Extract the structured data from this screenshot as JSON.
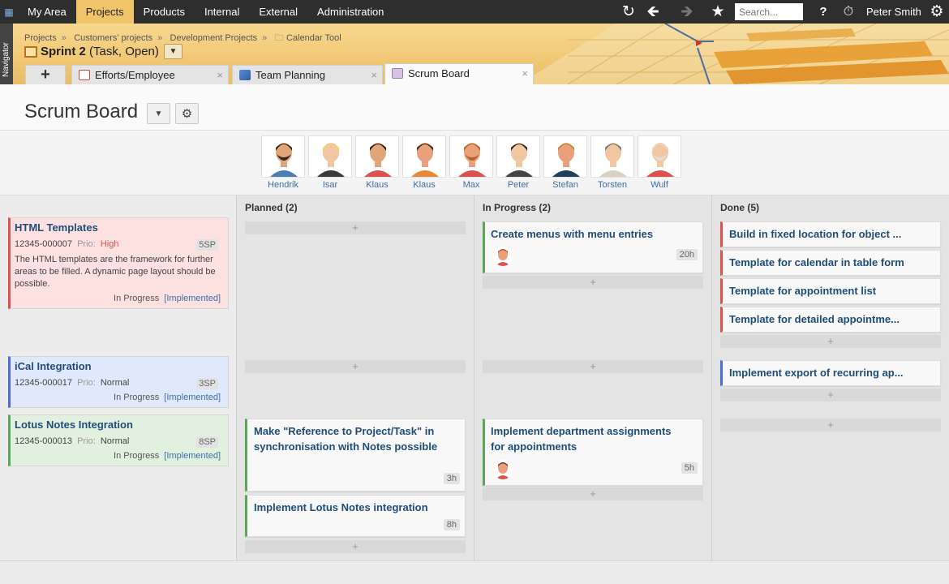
{
  "topnav": {
    "items": [
      "My Area",
      "Projects",
      "Products",
      "Internal",
      "External",
      "Administration"
    ],
    "active": "Projects",
    "search_placeholder": "Search...",
    "help": "?",
    "user": "Peter Smith"
  },
  "navigator_label": "Navigator",
  "breadcrumb": [
    "Projects",
    "Customers' projects",
    "Development Projects",
    "Calendar Tool"
  ],
  "object": {
    "name": "Sprint 2",
    "meta": "(Task, Open)"
  },
  "tabs": [
    {
      "label": "Efforts/Employee"
    },
    {
      "label": "Team Planning"
    },
    {
      "label": "Scrum Board"
    }
  ],
  "add_tab": "+",
  "page_title": "Scrum Board",
  "people": [
    "Hendrik",
    "Isar",
    "Klaus",
    "Klaus",
    "Max",
    "Peter",
    "Stefan",
    "Torsten",
    "Wulf"
  ],
  "stories": [
    {
      "title": "HTML Templates",
      "id": "12345-000007",
      "prio_label": "Prio:",
      "prio": "High",
      "sp": "5SP",
      "desc": "The HTML templates are the framework for further areas to be filled. A dynamic page layout should be possible.",
      "status": "In Progress",
      "state": "[Implemented]"
    },
    {
      "title": "iCal Integration",
      "id": "12345-000017",
      "prio_label": "Prio:",
      "prio": "Normal",
      "sp": "3SP",
      "status": "In Progress",
      "state": "[Implemented]"
    },
    {
      "title": "Lotus Notes Integration",
      "id": "12345-000013",
      "prio_label": "Prio:",
      "prio": "Normal",
      "sp": "8SP",
      "status": "In Progress",
      "state": "[Implemented]"
    }
  ],
  "columns": {
    "planned": {
      "title": "Planned (2)",
      "cards": [
        {
          "title": "Make \"Reference to Project/Task\" in synchronisation with Notes possible",
          "est": "3h"
        },
        {
          "title": "Implement Lotus Notes integration",
          "est": "8h"
        }
      ]
    },
    "progress": {
      "title": "In Progress (2)",
      "cards": [
        {
          "title": "Create menus with menu entries",
          "est": "20h"
        },
        {
          "title": "Implement department assignments for appointments",
          "est": "5h"
        }
      ]
    },
    "done": {
      "title": "Done (5)",
      "cards": [
        {
          "title": "Build in fixed location for object ..."
        },
        {
          "title": "Template for calendar in table form"
        },
        {
          "title": "Template for appointment list"
        },
        {
          "title": "Template for detailed appointme..."
        },
        {
          "title": "Implement export of recurring ap..."
        }
      ]
    }
  },
  "add_symbol": "+",
  "colors": {
    "high": "#d9534f",
    "red_bar": "#d9534f",
    "blue_bar": "#4a6fd0",
    "green_bar": "#5aa65a",
    "link": "#1f4d7a"
  }
}
